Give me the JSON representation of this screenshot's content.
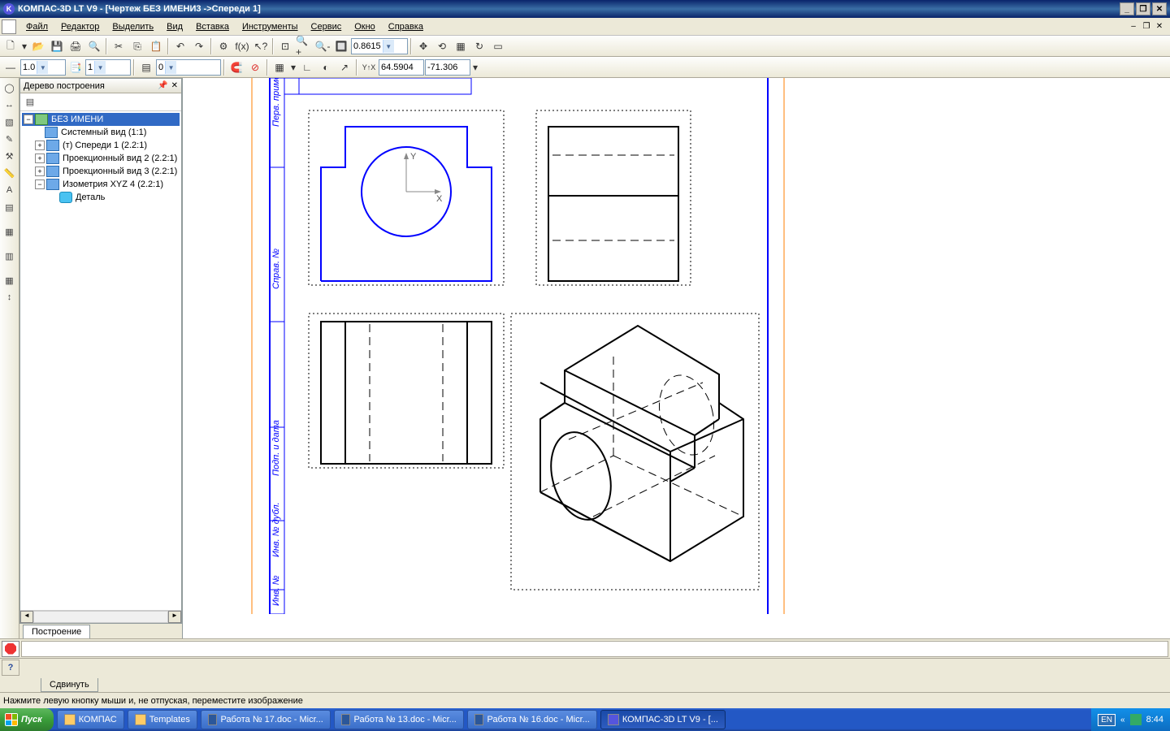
{
  "title": "КОМПАС-3D LT V9 - [Чертеж БЕЗ ИМЕНИ3 ->Спереди 1]",
  "menu": {
    "file": "Файл",
    "editor": "Редактор",
    "select": "Выделить",
    "view": "Вид",
    "insert": "Вставка",
    "tools": "Инструменты",
    "service": "Сервис",
    "window": "Окно",
    "help": "Справка"
  },
  "toolbar2": {
    "line_width": "1.0",
    "layer": "1",
    "style": "0",
    "zoom": "0.8615",
    "coordX": "64.5904",
    "coordY": "-71.306"
  },
  "tree": {
    "title": "Дерево построения",
    "root": "БЕЗ ИМЕНИ",
    "items": [
      {
        "label": "Системный вид (1:1)"
      },
      {
        "label": "(т) Спереди 1 (2.2:1)"
      },
      {
        "label": "Проекционный вид 2 (2.2:1)"
      },
      {
        "label": "Проекционный вид 3 (2.2:1)"
      },
      {
        "label": "Изометрия XYZ 4 (2.2:1)"
      }
    ],
    "detail": "Деталь"
  },
  "bottom_tab": "Построение",
  "cmd_tab": "Сдвинуть",
  "status": "Нажмите левую кнопку мыши и, не отпуская, переместите изображение",
  "taskbar": {
    "start": "Пуск",
    "items": [
      {
        "label": "КОМПАС"
      },
      {
        "label": "Templates"
      },
      {
        "label": "Работа № 17.doc - Micr..."
      },
      {
        "label": "Работа № 13.doc - Micr..."
      },
      {
        "label": "Работа № 16.doc - Micr..."
      },
      {
        "label": "КОМПАС-3D LT V9 - [...",
        "active": true
      }
    ],
    "lang": "EN",
    "time": "8:44"
  }
}
